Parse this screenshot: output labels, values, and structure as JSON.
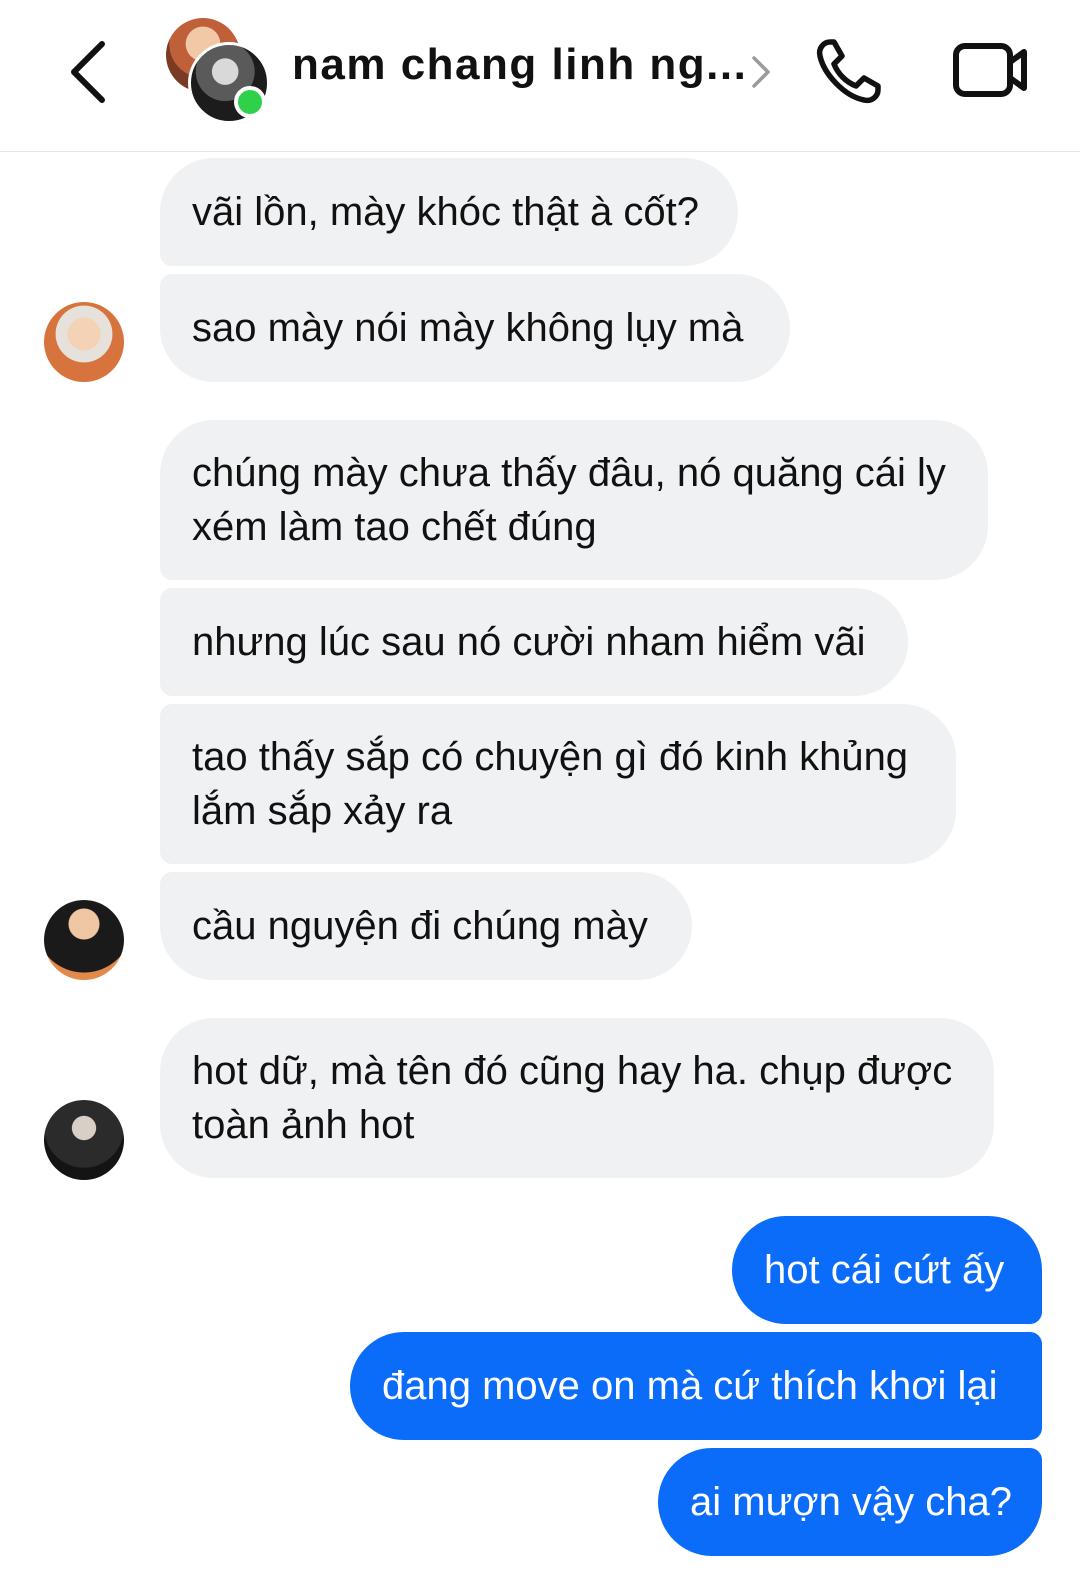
{
  "header": {
    "title": "nam chang linh ng...",
    "back_icon": "chevron-left-icon",
    "call_icon": "phone-icon",
    "video_icon": "video-camera-icon",
    "online": true
  },
  "messages": [
    {
      "direction": "incoming",
      "text": "vãi lồn, mày khóc thật à cốt?"
    },
    {
      "direction": "incoming",
      "text": "sao mày nói mày không lụy mà"
    },
    {
      "direction": "incoming",
      "lines": [
        "chúng mày chưa thấy đâu, nó quăng cái ly",
        "xém làm tao chết đúng"
      ]
    },
    {
      "direction": "incoming",
      "text": "nhưng lúc sau nó cười nham hiểm vãi"
    },
    {
      "direction": "incoming",
      "lines": [
        "tao thấy sắp có chuyện gì đó kinh khủng",
        "lắm sắp xảy ra"
      ]
    },
    {
      "direction": "incoming",
      "text": "cầu nguyện đi chúng mày"
    },
    {
      "direction": "incoming",
      "lines": [
        "hot dữ, mà tên đó cũng hay ha. chụp được",
        "toàn ảnh hot"
      ]
    },
    {
      "direction": "outgoing",
      "text": "hot cái cứt ấy"
    },
    {
      "direction": "outgoing",
      "text": "đang move on mà cứ thích khơi lại"
    },
    {
      "direction": "outgoing",
      "text": "ai mượn vậy cha?"
    }
  ],
  "colors": {
    "incoming_bubble": "#f0f1f3",
    "outgoing_bubble": "#0a6cf9",
    "online_indicator": "#30d14a"
  }
}
